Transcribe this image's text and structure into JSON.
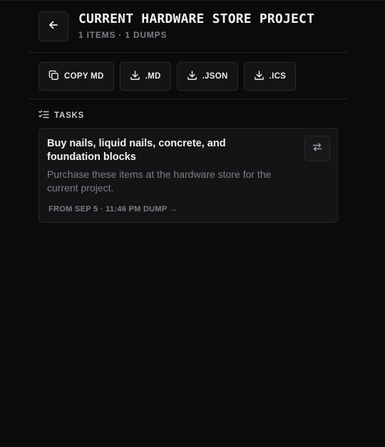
{
  "header": {
    "back_icon": "arrow-left-icon",
    "title": "CURRENT HARDWARE STORE PROJECT",
    "subtitle": "1 ITEMS · 1 DUMPS"
  },
  "toolbar": {
    "copy_md": {
      "label": "COPY MD",
      "icon": "copy-icon"
    },
    "download_md": {
      "label": ".MD",
      "icon": "download-icon"
    },
    "download_json": {
      "label": ".JSON",
      "icon": "download-icon"
    },
    "download_ics": {
      "label": ".ICS",
      "icon": "download-icon"
    }
  },
  "tasks": {
    "section_label": "TASKS",
    "section_icon": "list-checks-icon",
    "items": [
      {
        "title": "Buy nails, liquid nails, concrete, and foundation blocks",
        "description": "Purchase these items at the hardware store for the current project.",
        "source": "FROM SEP 5 · 11:46 PM DUMP →",
        "action_icon": "swap-arrows-icon"
      }
    ]
  },
  "colors": {
    "background": "#0b0b0c",
    "card": "#141416",
    "border": "#2a2a2e",
    "text": "#ececec",
    "muted": "#7e7e86"
  }
}
